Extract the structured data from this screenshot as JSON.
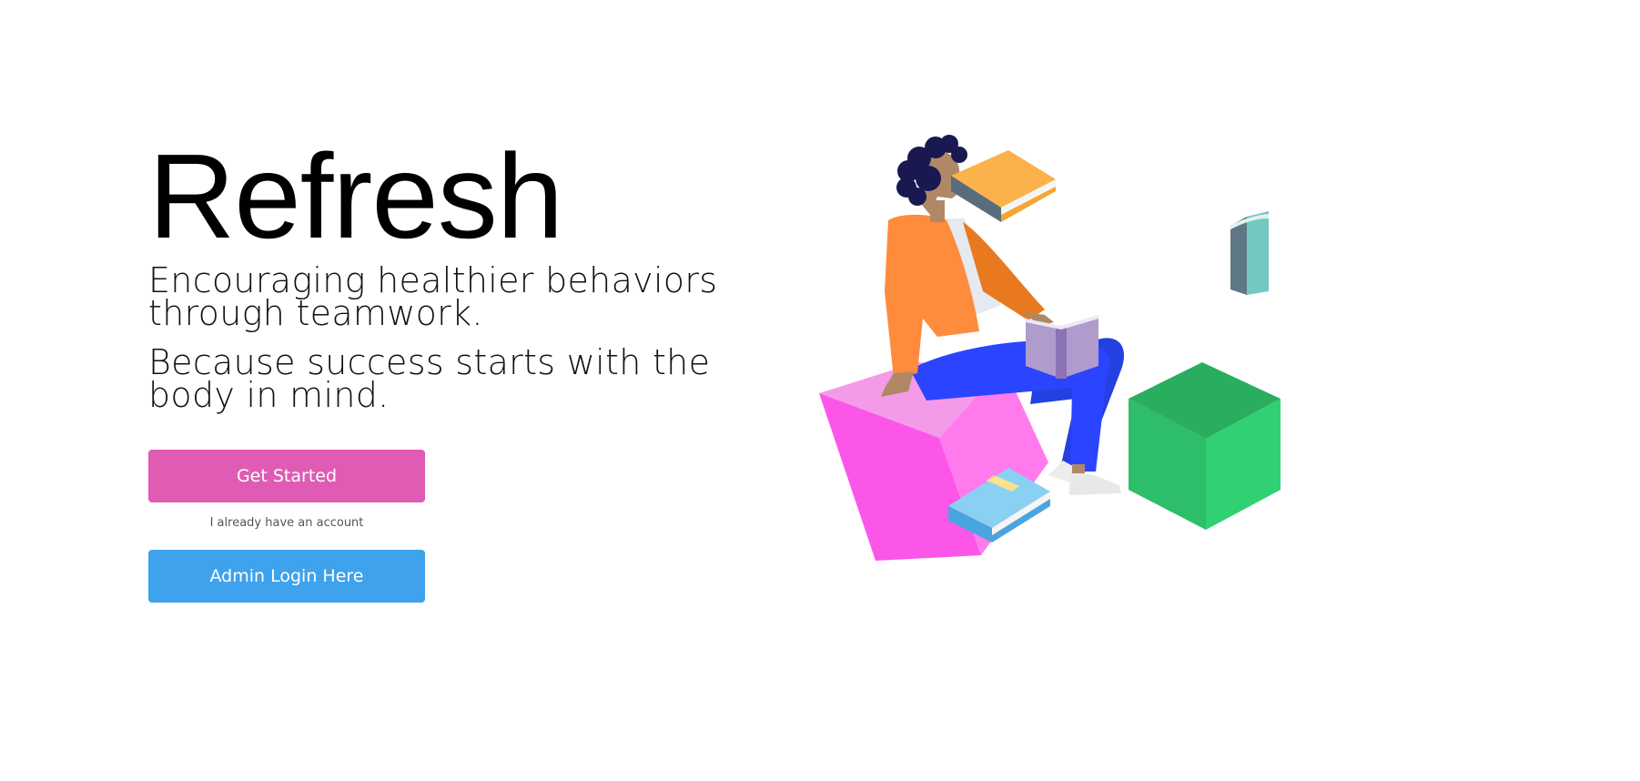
{
  "hero": {
    "title": "Refresh",
    "tagline_1": "Encouraging healthier behaviors through teamwork.",
    "tagline_2": "Because success starts with the body in mind."
  },
  "actions": {
    "get_started_label": "Get Started",
    "account_link_label": "I already have an account",
    "admin_login_label": "Admin Login Here"
  },
  "colors": {
    "get_started": "#e05bb3",
    "admin_login": "#3ea2ec",
    "cube_pink": "#ff5de8",
    "cube_green": "#2ebd69",
    "jacket": "#ff8b3d",
    "pants": "#2b44ff"
  },
  "illustration": {
    "name": "person-sitting-on-cube-with-books",
    "icons": [
      "person-figure",
      "pink-cube",
      "green-cube",
      "orange-book",
      "teal-book",
      "purple-open-book",
      "blue-book"
    ]
  }
}
